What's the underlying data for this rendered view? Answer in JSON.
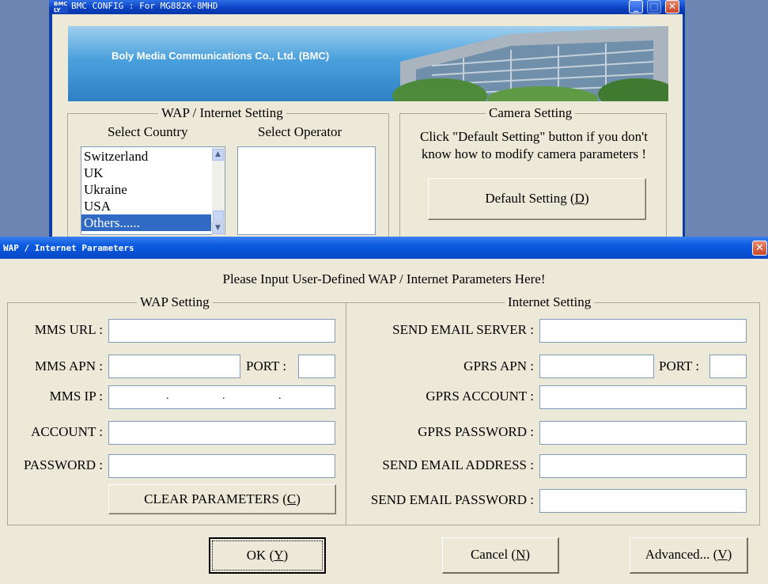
{
  "back_window": {
    "title": "BMC CONFIG : For MG882K-8MHD",
    "app_icon": "BMC LY",
    "buttons": {
      "minimize": "_",
      "maximize": "□",
      "close": "✕"
    },
    "banner_text": "Boly Media Communications Co., Ltd. (BMC)",
    "wap_group": {
      "title": "WAP / Internet Setting",
      "country_label": "Select Country",
      "operator_label": "Select Operator",
      "countries": [
        "Switzerland",
        "UK",
        "Ukraine",
        "USA",
        "Others......"
      ],
      "selected_index": 4,
      "operators": []
    },
    "camera_group": {
      "title": "Camera Setting",
      "hint": "Click \"Default Setting\" button if you don't know how to modify camera parameters !",
      "default_button": {
        "text": "Default Setting (",
        "hotkey": "D",
        "suffix": ")"
      }
    }
  },
  "dialog": {
    "title": "WAP / Internet Parameters",
    "close_glyph": "✕",
    "heading": "Please Input User-Defined WAP / Internet Parameters Here!",
    "wap_setting": {
      "title": "WAP Setting",
      "mms_url_label": "MMS URL :",
      "mms_apn_label": "MMS APN :",
      "port_label": "PORT :",
      "mms_ip_label": "MMS IP :",
      "ip_dots": [
        ".",
        ".",
        "."
      ],
      "account_label": "ACCOUNT :",
      "password_label": "PASSWORD :",
      "clear_button": {
        "text": "CLEAR PARAMETERS (",
        "hotkey": "C",
        "suffix": ")"
      },
      "values": {
        "mms_url": "",
        "mms_apn": "",
        "port": "",
        "account": "",
        "password": ""
      }
    },
    "internet_setting": {
      "title": "Internet Setting",
      "send_email_server_label": "SEND EMAIL SERVER :",
      "gprs_apn_label": "GPRS APN :",
      "port_label": "PORT :",
      "gprs_account_label": "GPRS ACCOUNT :",
      "gprs_password_label": "GPRS PASSWORD :",
      "send_email_address_label": "SEND EMAIL ADDRESS :",
      "send_email_password_label": "SEND EMAIL PASSWORD :",
      "values": {
        "send_email_server": "",
        "gprs_apn": "",
        "port": "",
        "gprs_account": "",
        "gprs_password": "",
        "send_email_address": "",
        "send_email_password": ""
      }
    },
    "buttons": {
      "ok": {
        "text": "OK (",
        "hotkey": "Y",
        "suffix": ")"
      },
      "cancel": {
        "text": "Cancel (",
        "hotkey": "N",
        "suffix": ")"
      },
      "advanced": {
        "text": "Advanced... (",
        "hotkey": "V",
        "suffix": ")"
      }
    }
  }
}
